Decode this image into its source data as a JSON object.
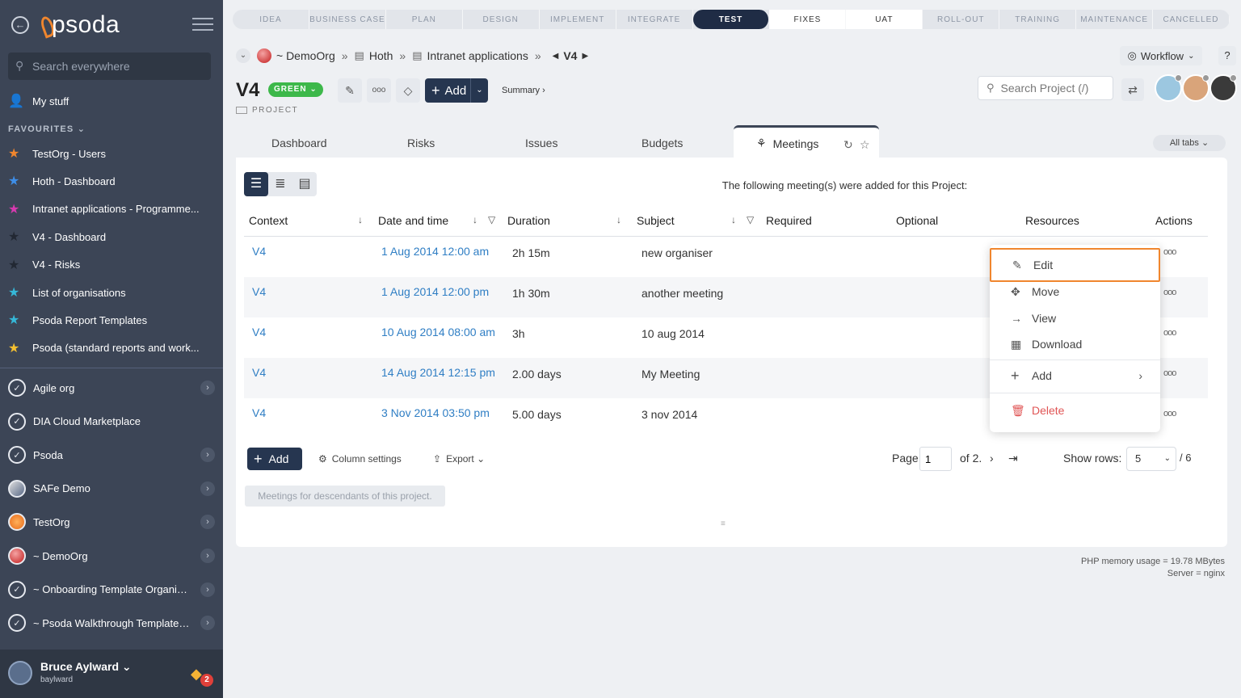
{
  "sidebar": {
    "logo": "psoda",
    "search_placeholder": "Search everywhere",
    "mystuff": "My stuff",
    "favourites_header": "FAVOURITES",
    "favourites": [
      {
        "label": "TestOrg - Users",
        "color": "#f0862e"
      },
      {
        "label": "Hoth - Dashboard",
        "color": "#3e8ee8"
      },
      {
        "label": "Intranet applications - Programme...",
        "color": "#d63aaf"
      },
      {
        "label": "V4 - Dashboard",
        "color": "#222833"
      },
      {
        "label": "V4 - Risks",
        "color": "#222833"
      },
      {
        "label": "List of organisations",
        "color": "#35b8d8"
      },
      {
        "label": "Psoda Report Templates",
        "color": "#35b8d8"
      },
      {
        "label": "Psoda (standard reports and work...",
        "color": "#f5c030"
      }
    ],
    "orgs": [
      {
        "label": "Agile org",
        "chevron": true
      },
      {
        "label": "DIA Cloud Marketplace",
        "chevron": false
      },
      {
        "label": "Psoda",
        "chevron": true
      },
      {
        "label": "SAFe Demo",
        "chevron": true
      },
      {
        "label": "TestOrg",
        "chevron": true
      },
      {
        "label": "~ DemoOrg",
        "chevron": true
      },
      {
        "label": "~ Onboarding Template Organisa...",
        "chevron": true
      },
      {
        "label": "~ Psoda Walkthrough Template P...",
        "chevron": true
      }
    ],
    "user": {
      "name": "Bruce Aylward",
      "login": "baylward",
      "notifications": "2"
    }
  },
  "stages": [
    {
      "label": "IDEA",
      "state": "todo"
    },
    {
      "label": "BUSINESS CASE",
      "state": "todo"
    },
    {
      "label": "PLAN",
      "state": "todo"
    },
    {
      "label": "DESIGN",
      "state": "todo"
    },
    {
      "label": "IMPLEMENT",
      "state": "todo"
    },
    {
      "label": "INTEGRATE",
      "state": "todo"
    },
    {
      "label": "TEST",
      "state": "active"
    },
    {
      "label": "FIXES",
      "state": "done"
    },
    {
      "label": "UAT",
      "state": "done"
    },
    {
      "label": "ROLL-OUT",
      "state": "todo"
    },
    {
      "label": "TRAINING",
      "state": "todo"
    },
    {
      "label": "MAINTENANCE",
      "state": "todo"
    },
    {
      "label": "CANCELLED",
      "state": "todo"
    }
  ],
  "breadcrumb": {
    "org": "~ DemoOrg",
    "portfolio": "Hoth",
    "programme": "Intranet applications",
    "project": "V4",
    "sep": "»"
  },
  "header": {
    "workflow": "Workflow",
    "help": "?",
    "title": "V4",
    "status": "GREEN",
    "type": "PROJECT",
    "add": "Add",
    "summary": "Summary ›",
    "search_placeholder": "Search Project (/)"
  },
  "tabs": {
    "items": [
      "Dashboard",
      "Risks",
      "Issues",
      "Budgets"
    ],
    "active": "Meetings",
    "all": "All tabs"
  },
  "table": {
    "intro": "The following meeting(s) were added for this Project:",
    "columns": [
      "Context",
      "Date and time",
      "Duration",
      "Subject",
      "Required",
      "Optional",
      "Resources",
      "Actions"
    ],
    "rows": [
      {
        "context": "V4",
        "date": "1 Aug 2014 12:00 am",
        "duration": "2h 15m",
        "subject": "new organiser"
      },
      {
        "context": "V4",
        "date": "1 Aug 2014 12:00 pm",
        "duration": "1h 30m",
        "subject": "another meeting"
      },
      {
        "context": "V4",
        "date": "10 Aug 2014 08:00 am",
        "duration": "3h",
        "subject": "10 aug 2014"
      },
      {
        "context": "V4",
        "date": "14 Aug 2014 12:15 pm",
        "duration": "2.00 days",
        "subject": "My Meeting"
      },
      {
        "context": "V4",
        "date": "3 Nov 2014 03:50 pm",
        "duration": "5.00 days",
        "subject": "3 nov 2014"
      }
    ]
  },
  "footer": {
    "add": "Add",
    "column_settings": "Column settings",
    "export": "Export",
    "page_label": "Page",
    "page_value": "1",
    "of_pages": "of 2.",
    "show_rows_label": "Show rows:",
    "rows_value": "5",
    "total": "/ 6",
    "descendants": "Meetings for descendants of this project."
  },
  "menu": {
    "edit": "Edit",
    "move": "Move",
    "view": "View",
    "download": "Download",
    "add": "Add",
    "delete": "Delete"
  },
  "memory": {
    "php": "PHP memory usage = 19.78 MBytes",
    "server": "Server = nginx"
  }
}
